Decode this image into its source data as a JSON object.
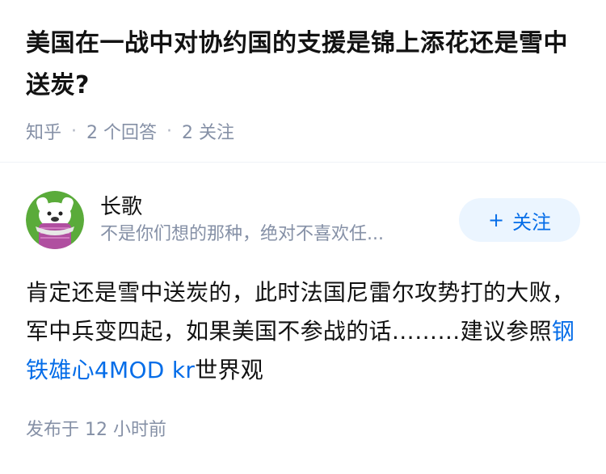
{
  "question": {
    "title": "美国在一战中对协约国的支援是锦上添花还是雪中送炭?",
    "source": "知乎",
    "answers_count": "2 个回答",
    "followers_count": "2 关注"
  },
  "answer": {
    "author": {
      "name": "长歌",
      "bio": "不是你们想的那种，绝对不喜欢任...",
      "avatar_icon": "cartoon-character-avatar"
    },
    "follow_button": {
      "plus": "+",
      "label": "关注"
    },
    "content": {
      "text_before": "肯定还是雪中送炭的，此时法国尼雷尔攻势打的大败，军中兵变四起，如果美国不参战的话………建议参照",
      "link_text": "钢铁雄心4MOD kr",
      "text_after": "世界观"
    },
    "publish_time": "发布于 12 小时前"
  },
  "colors": {
    "primary_blue": "#056de8",
    "follow_bg": "#ebf5ff",
    "meta_gray": "#8590a6",
    "title_black": "#121212"
  }
}
